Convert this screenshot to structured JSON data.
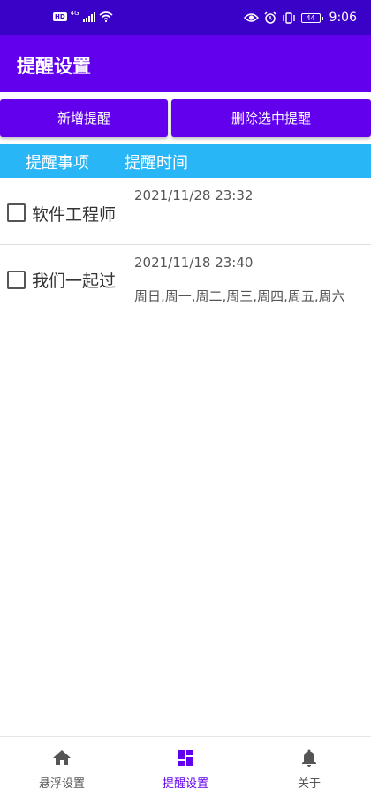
{
  "status_bar": {
    "hd": "HD",
    "network": "4G",
    "battery": "44",
    "time": "9:06"
  },
  "app_bar": {
    "title": "提醒设置"
  },
  "actions": {
    "add_label": "新增提醒",
    "delete_label": "删除选中提醒"
  },
  "list_header": {
    "col1": "提醒事项",
    "col2": "提醒时间"
  },
  "reminders": [
    {
      "title": "软件工程师",
      "time": "2021/11/28  23:32",
      "repeat": "",
      "checked": false
    },
    {
      "title": "我们一起过",
      "time": "2021/11/18  23:40",
      "repeat": "周日,周一,周二,周三,周四,周五,周六",
      "checked": false
    }
  ],
  "bottom_nav": {
    "items": [
      {
        "label": "悬浮设置",
        "icon": "home-icon",
        "active": false
      },
      {
        "label": "提醒设置",
        "icon": "dashboard-icon",
        "active": true
      },
      {
        "label": "关于",
        "icon": "bell-icon",
        "active": false
      }
    ]
  },
  "colors": {
    "primary": "#6200ee",
    "status_bar": "#3a01c7",
    "header_strip": "#29b6f6",
    "nav_inactive": "#555555"
  }
}
